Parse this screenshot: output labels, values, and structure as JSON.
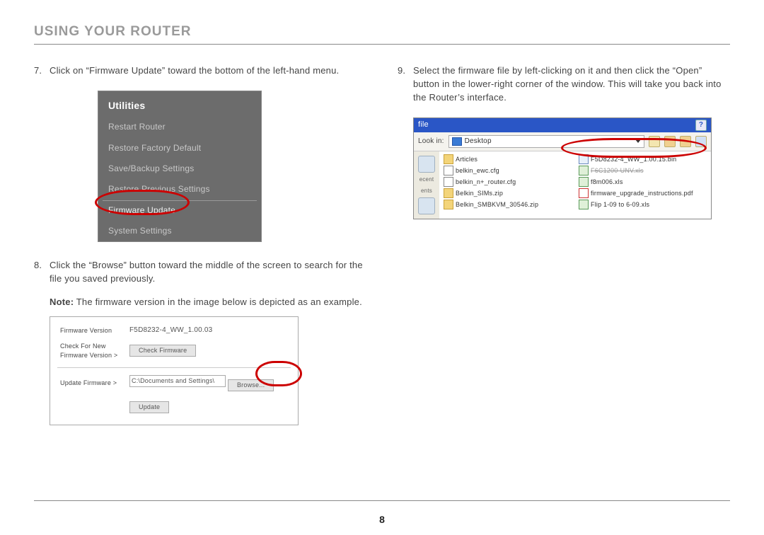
{
  "page": {
    "title": "USING YOUR ROUTER",
    "number": "8"
  },
  "steps": {
    "s7": {
      "num": "7.",
      "text": "Click on “Firmware Update” toward the bottom of the left-hand menu."
    },
    "s8": {
      "num": "8.",
      "text": "Click the “Browse” button toward the middle of the screen to search for the file you saved previously."
    },
    "s8note_bold": "Note:",
    "s8note_rest": " The firmware version in the image below is depicted as an example.",
    "s9": {
      "num": "9.",
      "text": "Select the firmware file by left-clicking on it and then click the “Open” button in the lower-right corner of the window. This will take you back into the Router’s interface."
    }
  },
  "utilities": {
    "heading": "Utilities",
    "items": [
      "Restart Router",
      "Restore Factory Default",
      "Save/Backup Settings",
      "Restore Previous Settings",
      "Firmware Update",
      "System Settings"
    ]
  },
  "firmware_panel": {
    "row1_label": "Firmware Version",
    "row1_value": "F5D8232-4_WW_1.00.03",
    "row2_label": "Check For New Firmware Version >",
    "row2_button": "Check Firmware",
    "row3_label": "Update Firmware >",
    "row3_value": "C:\\Documents and Settings\\",
    "row3_button": "Browse...",
    "row4_button": "Update"
  },
  "open_dialog": {
    "title": "file",
    "lookin_label": "Look in:",
    "lookin_value": "Desktop",
    "side_labels": [
      "ecent",
      "ents"
    ],
    "left_files": [
      {
        "icon": "folder",
        "name": "Articles"
      },
      {
        "icon": "cfg",
        "name": "belkin_ewc.cfg"
      },
      {
        "icon": "cfg",
        "name": "belkin_n+_router.cfg"
      },
      {
        "icon": "zip",
        "name": "Belkin_SIMs.zip"
      },
      {
        "icon": "zip",
        "name": "Belkin_SMBKVM_30546.zip"
      }
    ],
    "right_files": [
      {
        "icon": "bin",
        "name": "F5D8232-4_WW_1.00.15.bin"
      },
      {
        "icon": "xls",
        "name": "F6C1200-UNV.xls",
        "strike": true
      },
      {
        "icon": "xls",
        "name": "f8m006.xls"
      },
      {
        "icon": "pdf",
        "name": "firmware_upgrade_instructions.pdf"
      },
      {
        "icon": "xls",
        "name": "Flip 1-09 to 6-09.xls"
      }
    ]
  }
}
